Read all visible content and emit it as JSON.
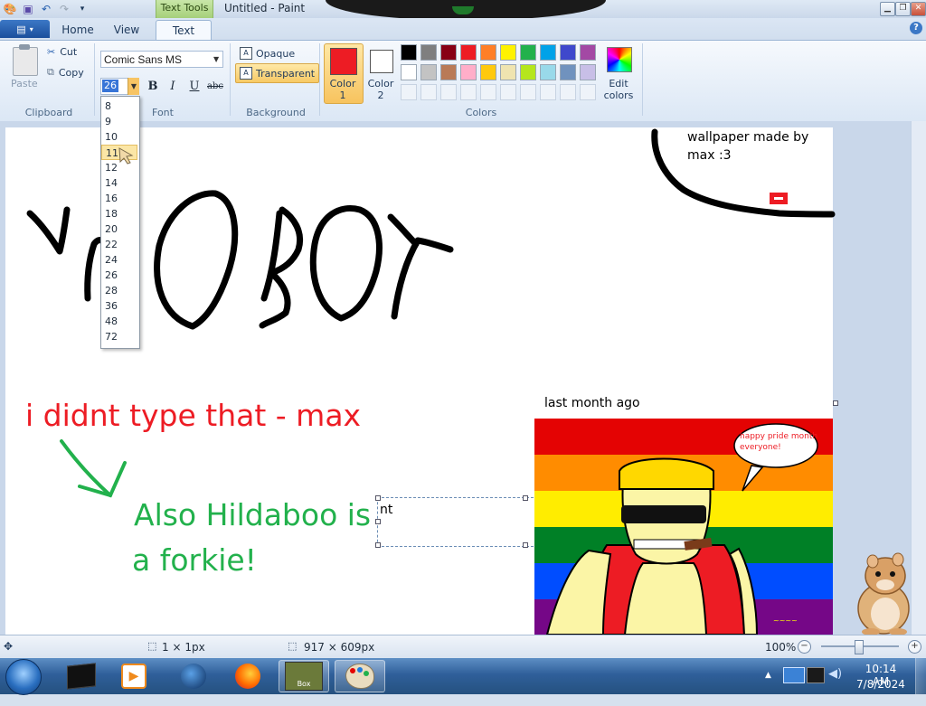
{
  "window": {
    "title": "Untitled - Paint",
    "context_tab": "Text Tools"
  },
  "tabs": [
    {
      "label": "Home"
    },
    {
      "label": "View"
    },
    {
      "label": "Text"
    }
  ],
  "clipboard": {
    "paste_label": "Paste",
    "cut_label": "Cut",
    "copy_label": "Copy",
    "group_label": "Clipboard"
  },
  "font": {
    "name": "Comic Sans MS",
    "size": "26",
    "group_label": "Font",
    "bold": "B",
    "italic": "I",
    "underline": "U",
    "strikethrough": "abc",
    "size_options": [
      "8",
      "9",
      "10",
      "11",
      "12",
      "14",
      "16",
      "18",
      "20",
      "22",
      "24",
      "26",
      "28",
      "36",
      "48",
      "72"
    ],
    "hovered_size": "11"
  },
  "background": {
    "opaque_label": "Opaque",
    "transparent_label": "Transparent",
    "selected": "Transparent",
    "group_label": "Background"
  },
  "colors": {
    "color1_label": "Color 1",
    "color1_value": "#ed1c24",
    "color2_label": "Color 2",
    "color2_value": "#ffffff",
    "edit_label": "Edit colors",
    "group_label": "Colors",
    "palette": [
      "#000000",
      "#7f7f7f",
      "#880015",
      "#ed1c24",
      "#ff7f27",
      "#fff200",
      "#22b14c",
      "#00a2e8",
      "#3f48cc",
      "#a349a4",
      "#ffffff",
      "#c3c3c3",
      "#b97a57",
      "#ffaec9",
      "#ffc90e",
      "#efe4b0",
      "#b5e61d",
      "#99d9ea",
      "#7092be",
      "#c8bfe7",
      "",
      "",
      "",
      "",
      "",
      "",
      "",
      "",
      "",
      ""
    ]
  },
  "canvas": {
    "drawn_word": "YMOBOY",
    "red_note": "i didnt type that - max",
    "green_note_line1": "Also Hildaboo is",
    "green_note_line2": "a forkie!",
    "wallpaper_note_line1": "wallpaper made by",
    "wallpaper_note_line2": "max :3",
    "last_month_caption": "last month ago",
    "text_box_value": "nt",
    "speech_bubble": "happy pride month everyone!"
  },
  "status": {
    "cursor_size": "1 × 1px",
    "canvas_size": "917 × 609px",
    "zoom": "100%"
  },
  "taskbar": {
    "time": "10:14 AM",
    "date": "7/8/2024",
    "items": [
      "unknown-app-icon",
      "media-player-icon",
      "browser-globe-icon",
      "firefox-icon",
      "box-game-icon",
      "paint-icon"
    ]
  }
}
